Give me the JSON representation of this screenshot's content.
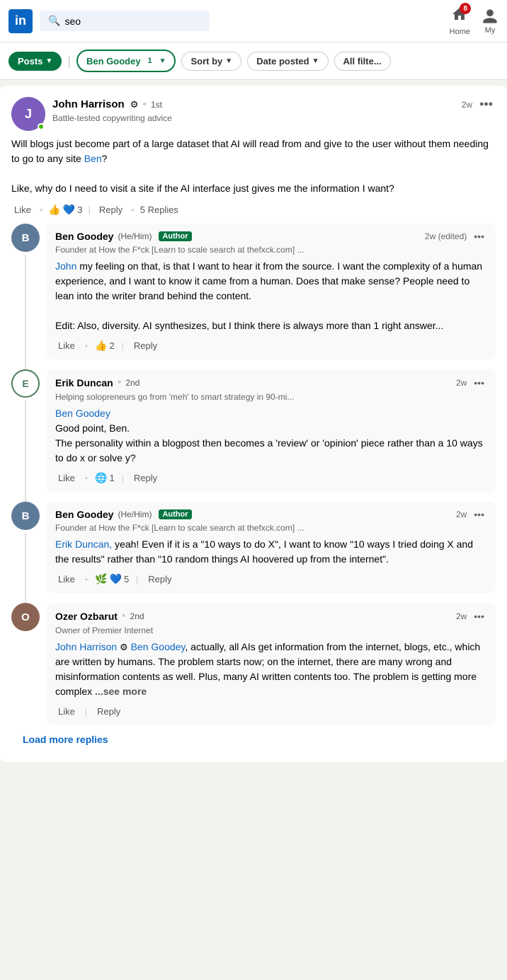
{
  "nav": {
    "logo": "in",
    "search_placeholder": "seo",
    "home_label": "Home",
    "my_label": "My",
    "notification_count": "8"
  },
  "filters": {
    "posts_label": "Posts",
    "ben_goodey_label": "Ben Goodey",
    "ben_goodey_count": "1",
    "sort_by_label": "Sort by",
    "date_posted_label": "Date posted",
    "all_filters_label": "All filte..."
  },
  "post": {
    "author_name": "John Harrison",
    "author_verified": "⚙",
    "author_connection": "1st",
    "author_tagline": "Battle-tested copywriting advice",
    "time": "2w",
    "body_line1": "Will blogs just become part of a large dataset that AI will read from and give to the user without them needing to go to any site ",
    "ben_mention": "Ben",
    "body_line2": "?",
    "body_line3": "Like, why do I need to visit a site if the AI interface just gives me the information I want?",
    "reactions_emoji": [
      "👍",
      "💙"
    ],
    "reactions_count": "3",
    "reply_label": "Reply",
    "replies_label": "5 Replies",
    "like_label": "Like"
  },
  "comments": [
    {
      "id": "c1",
      "author_name": "Ben Goodey",
      "pronouns": "(He/Him)",
      "is_author": true,
      "author_badge": "Author",
      "connection": "",
      "tagline": "Founder at How the F*ck [Learn to scale search at thefxck.com] ...",
      "time": "2w (edited)",
      "mention": "John",
      "body": "my feeling on that, is that I want to hear it from the source. I want the complexity of a human experience, and I want to know it came from a human. Does that make sense? People need to lean into the writer brand behind the content.",
      "edit_note": "Edit: Also, diversity. AI synthesizes, but I think there is always more than 1 right answer...",
      "like_label": "Like",
      "reply_label": "Reply",
      "reactions_emoji": [
        "👍"
      ],
      "reactions_count": "2"
    },
    {
      "id": "c2",
      "author_name": "Erik Duncan",
      "pronouns": "",
      "is_author": false,
      "connection": "2nd",
      "tagline": "Helping solopreneurs go from 'meh' to smart strategy in 90-mi...",
      "time": "2w",
      "mention": "Ben Goodey",
      "body": "Good point, Ben.\nThe personality within a blogpost then becomes a 'review' or 'opinion' piece rather than a 10 ways to do x or solve y?",
      "like_label": "Like",
      "reply_label": "Reply",
      "reactions_emoji": [
        "🌐"
      ],
      "reactions_count": "1"
    },
    {
      "id": "c3",
      "author_name": "Ben Goodey",
      "pronouns": "(He/Him)",
      "is_author": true,
      "author_badge": "Author",
      "connection": "",
      "tagline": "Founder at How the F*ck [Learn to scale search at thefxck.com] ...",
      "time": "2w",
      "mention": "Erik Duncan,",
      "body": "yeah! Even if it is a \"10 ways to do X\", I want to know \"10 ways I tried doing X and the results\" rather than \"10 random things AI hoovered up from the internet\".",
      "like_label": "Like",
      "reply_label": "Reply",
      "reactions_emoji": [
        "🌿",
        "💙"
      ],
      "reactions_count": "5"
    },
    {
      "id": "c4",
      "author_name": "Ozer Ozbarut",
      "pronouns": "",
      "is_author": false,
      "connection": "2nd",
      "tagline": "Owner of Premier Internet",
      "time": "2w",
      "mention1": "John Harrison",
      "mention1_verified": "⚙",
      "mention2": "Ben Goodey",
      "body": ", actually, all AIs get information from the internet, blogs, etc., which are written by humans. The problem starts now; on the internet, there are many wrong and misinformation contents as well. Plus, many AI written contents too. The problem is getting more complex",
      "see_more": "...see more",
      "like_label": "Like",
      "reply_label": "Reply"
    }
  ],
  "load_more": "Load more replies"
}
